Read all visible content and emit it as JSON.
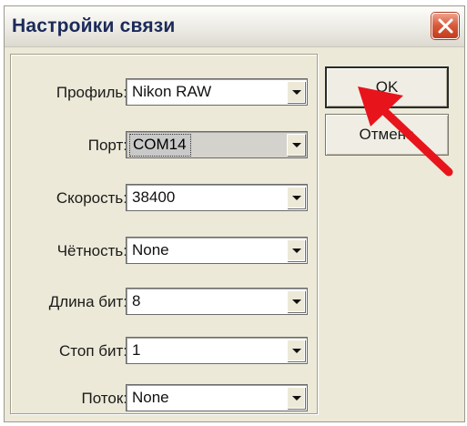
{
  "window": {
    "title": "Настройки связи"
  },
  "fields": [
    {
      "label": "Профиль:",
      "value": "Nikon RAW"
    },
    {
      "label": "Порт:",
      "value": "COM14"
    },
    {
      "label": "Скорость:",
      "value": "38400"
    },
    {
      "label": "Чётность:",
      "value": "None"
    },
    {
      "label": "Длина бит:",
      "value": "8"
    },
    {
      "label": "Стоп бит:",
      "value": "1"
    },
    {
      "label": "Поток:",
      "value": "None"
    }
  ],
  "buttons": {
    "ok": "OK",
    "cancel": "Отмена"
  },
  "icons": {
    "close": "close-icon",
    "dropdown": "chevron-down-icon",
    "annotation": "red-arrow-icon"
  },
  "colors": {
    "annotation_arrow": "#e8141c",
    "close_button": "#d65838",
    "title_text": "#1b2a5a"
  }
}
